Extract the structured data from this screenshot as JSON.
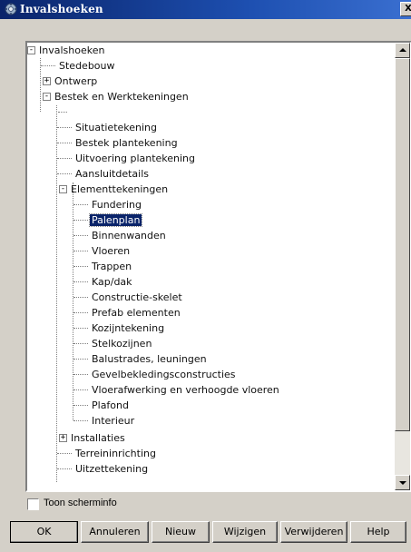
{
  "window": {
    "title": "Invalshoeken",
    "close_glyph": "X"
  },
  "tree": {
    "items": [
      {
        "label": "Invalshoeken",
        "expander": "-"
      },
      {
        "label": "Stedebouw"
      },
      {
        "label": "Ontwerp",
        "expander": "+"
      },
      {
        "label": "Bestek en Werktekeningen",
        "expander": "-"
      },
      {
        "label": "Situatietekening"
      },
      {
        "label": "Bestek plantekening"
      },
      {
        "label": "Uitvoering plantekening"
      },
      {
        "label": "Aansluitdetails"
      },
      {
        "label": "Elementtekeningen",
        "expander": "-"
      },
      {
        "label": "Fundering"
      },
      {
        "label": "Palenplan",
        "selected": true
      },
      {
        "label": "Binnenwanden"
      },
      {
        "label": "Vloeren"
      },
      {
        "label": "Trappen"
      },
      {
        "label": "Kap/dak"
      },
      {
        "label": "Constructie-skelet"
      },
      {
        "label": "Prefab elementen"
      },
      {
        "label": "Kozijntekening"
      },
      {
        "label": "Stelkozijnen"
      },
      {
        "label": "Balustrades, leuningen"
      },
      {
        "label": "Gevelbekledingsconstructies"
      },
      {
        "label": "Vloerafwerking en verhoogde vloeren"
      },
      {
        "label": "Plafond"
      },
      {
        "label": "Interieur"
      },
      {
        "label": "Installaties",
        "expander": "+"
      },
      {
        "label": "Terreininrichting"
      },
      {
        "label": "Uitzettekening"
      }
    ]
  },
  "options": {
    "toon_scherminfo_label": "Toon scherminfo",
    "toon_scherminfo_checked": false
  },
  "buttons": {
    "ok": "OK",
    "annuleren": "Annuleren",
    "nieuw": "Nieuw",
    "wijzigen": "Wijzigen",
    "verwijderen": "Verwijderen",
    "help": "Help"
  },
  "colors": {
    "titlebar": "#0a246a",
    "selection": "#0a246a",
    "dialog_bg": "#d4d0c8"
  }
}
